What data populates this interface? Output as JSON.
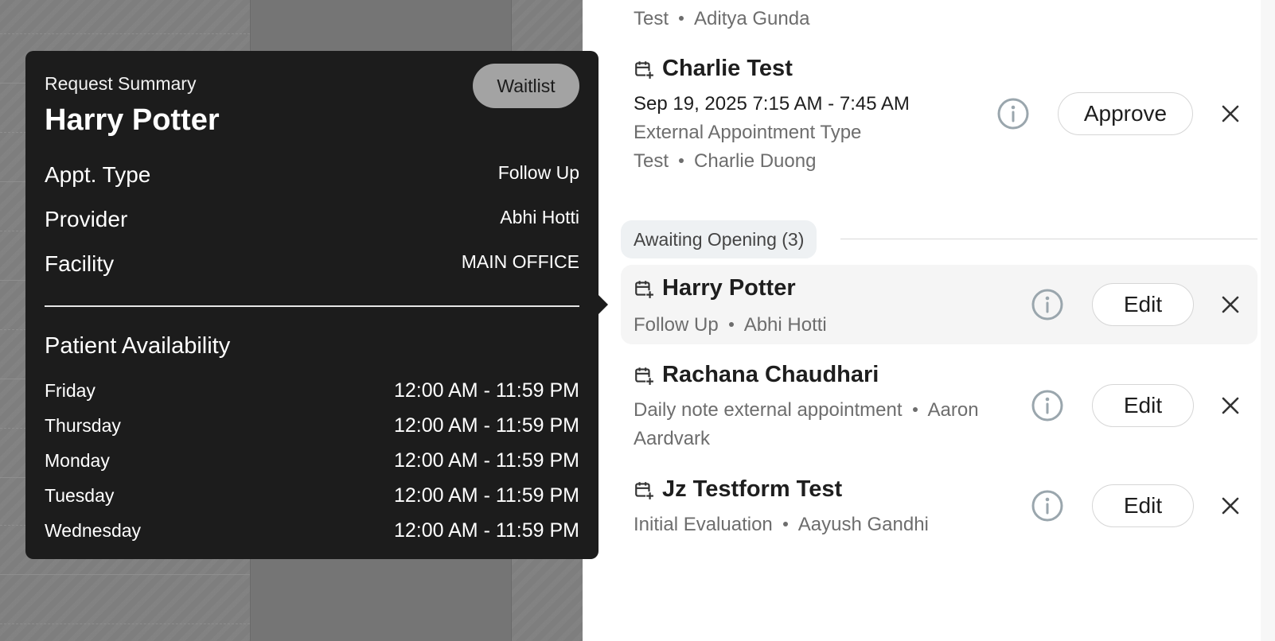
{
  "popover": {
    "kicker": "Request Summary",
    "patient_name": "Harry Potter",
    "status_button": "Waitlist",
    "details": [
      {
        "label": "Appt. Type",
        "value": "Follow Up"
      },
      {
        "label": "Provider",
        "value": "Abhi Hotti"
      },
      {
        "label": "Facility",
        "value": "MAIN OFFICE"
      }
    ],
    "availability_title": "Patient Availability",
    "availability": [
      {
        "day": "Friday",
        "hours": "12:00 AM - 11:59 PM"
      },
      {
        "day": "Thursday",
        "hours": "12:00 AM - 11:59 PM"
      },
      {
        "day": "Monday",
        "hours": "12:00 AM - 11:59 PM"
      },
      {
        "day": "Tuesday",
        "hours": "12:00 AM - 11:59 PM"
      },
      {
        "day": "Wednesday",
        "hours": "12:00 AM - 11:59 PM"
      }
    ]
  },
  "panel": {
    "top_partial": {
      "type": "Test",
      "provider": "Aditya Gunda"
    },
    "pending": {
      "name": "Charlie Test",
      "datetime": "Sep 19, 2025 7:15 AM - 7:45 AM",
      "appt_type": "External Appointment Type",
      "type": "Test",
      "provider": "Charlie Duong",
      "action": "Approve"
    },
    "section_label": "Awaiting Opening (3)",
    "awaiting": [
      {
        "name": "Harry Potter",
        "appt_type": "Follow Up",
        "provider": "Abhi Hotti",
        "action": "Edit"
      },
      {
        "name": "Rachana Chaudhari",
        "appt_type": "Daily note external appointment",
        "provider_first": "Aaron",
        "provider_last": "Aardvark",
        "action": "Edit"
      },
      {
        "name": "Jz Testform Test",
        "appt_type": "Initial Evaluation",
        "provider": "Aayush Gandhi",
        "action": "Edit"
      }
    ]
  },
  "icons": {
    "calendar": "calendar-plus-icon",
    "info": "info-circle-icon",
    "close": "close-icon"
  },
  "colors": {
    "popover_bg": "#1c1c1c",
    "waitlist_bg": "#a3a3a3",
    "section_bg": "#eef1f3",
    "info_icon": "#9aa6ad"
  }
}
